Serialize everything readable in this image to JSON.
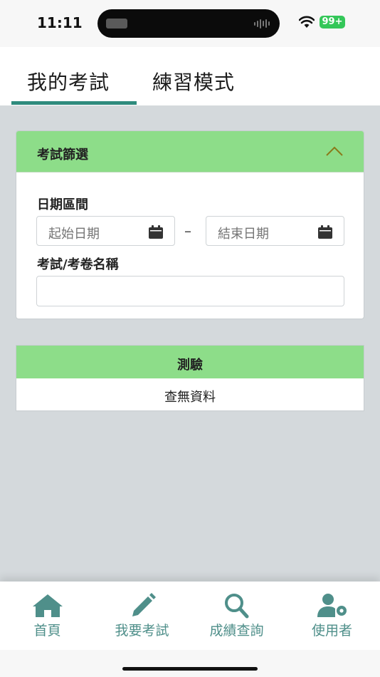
{
  "status_bar": {
    "time": "11:11",
    "battery": "99+"
  },
  "tabs": {
    "my_exams": "我的考試",
    "practice_mode": "練習模式",
    "active": "my_exams"
  },
  "filter": {
    "title": "考試篩選",
    "date_range_label": "日期區間",
    "start_date_placeholder": "起始日期",
    "range_separator": "–",
    "end_date_placeholder": "結束日期",
    "exam_name_label": "考試/考卷名稱",
    "exam_name_value": ""
  },
  "results": {
    "title": "測驗",
    "empty_text": "查無資料"
  },
  "bottom_nav": [
    {
      "label": "首頁",
      "icon": "home-icon"
    },
    {
      "label": "我要考試",
      "icon": "pencil-icon"
    },
    {
      "label": "成績查詢",
      "icon": "search-icon"
    },
    {
      "label": "使用者",
      "icon": "user-settings-icon"
    }
  ],
  "colors": {
    "accent": "#2f8b7d",
    "header_green": "#8ddd89",
    "nav_icon": "#4f8f8a",
    "background": "#d4d9dc"
  }
}
